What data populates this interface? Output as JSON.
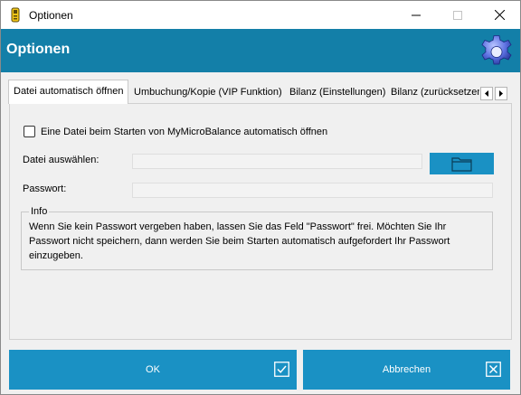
{
  "window": {
    "title": "Optionen",
    "header_title": "Optionen"
  },
  "tabs": [
    {
      "label": "Datei automatisch öffnen",
      "active": true
    },
    {
      "label": "Umbuchung/Kopie (VIP Funktion)",
      "active": false
    },
    {
      "label": "Bilanz (Einstellungen)",
      "active": false
    },
    {
      "label": "Bilanz (zurücksetzen)",
      "active": false
    }
  ],
  "autoopen": {
    "checkbox_label": "Eine Datei beim Starten von MyMicroBalance automatisch öffnen",
    "checkbox_checked": false,
    "file_label": "Datei auswählen:",
    "file_value": "",
    "password_label": "Passwort:",
    "password_value": ""
  },
  "info": {
    "title": "Info",
    "text": "Wenn Sie kein Passwort vergeben haben, lassen Sie das Feld \"Passwort\" frei. Möchten Sie Ihr Passwort nicht speichern, dann werden Sie beim Starten automatisch aufgefordert Ihr Passwort einzugeben."
  },
  "buttons": {
    "ok_label": "OK",
    "cancel_label": "Abbrechen"
  },
  "colors": {
    "header": "#137fa8",
    "button": "#1a91c4"
  },
  "icons": {
    "app": "app-icon",
    "header": "gear-icon",
    "browse": "folder-icon",
    "ok": "check-box-icon",
    "cancel": "x-box-icon"
  }
}
